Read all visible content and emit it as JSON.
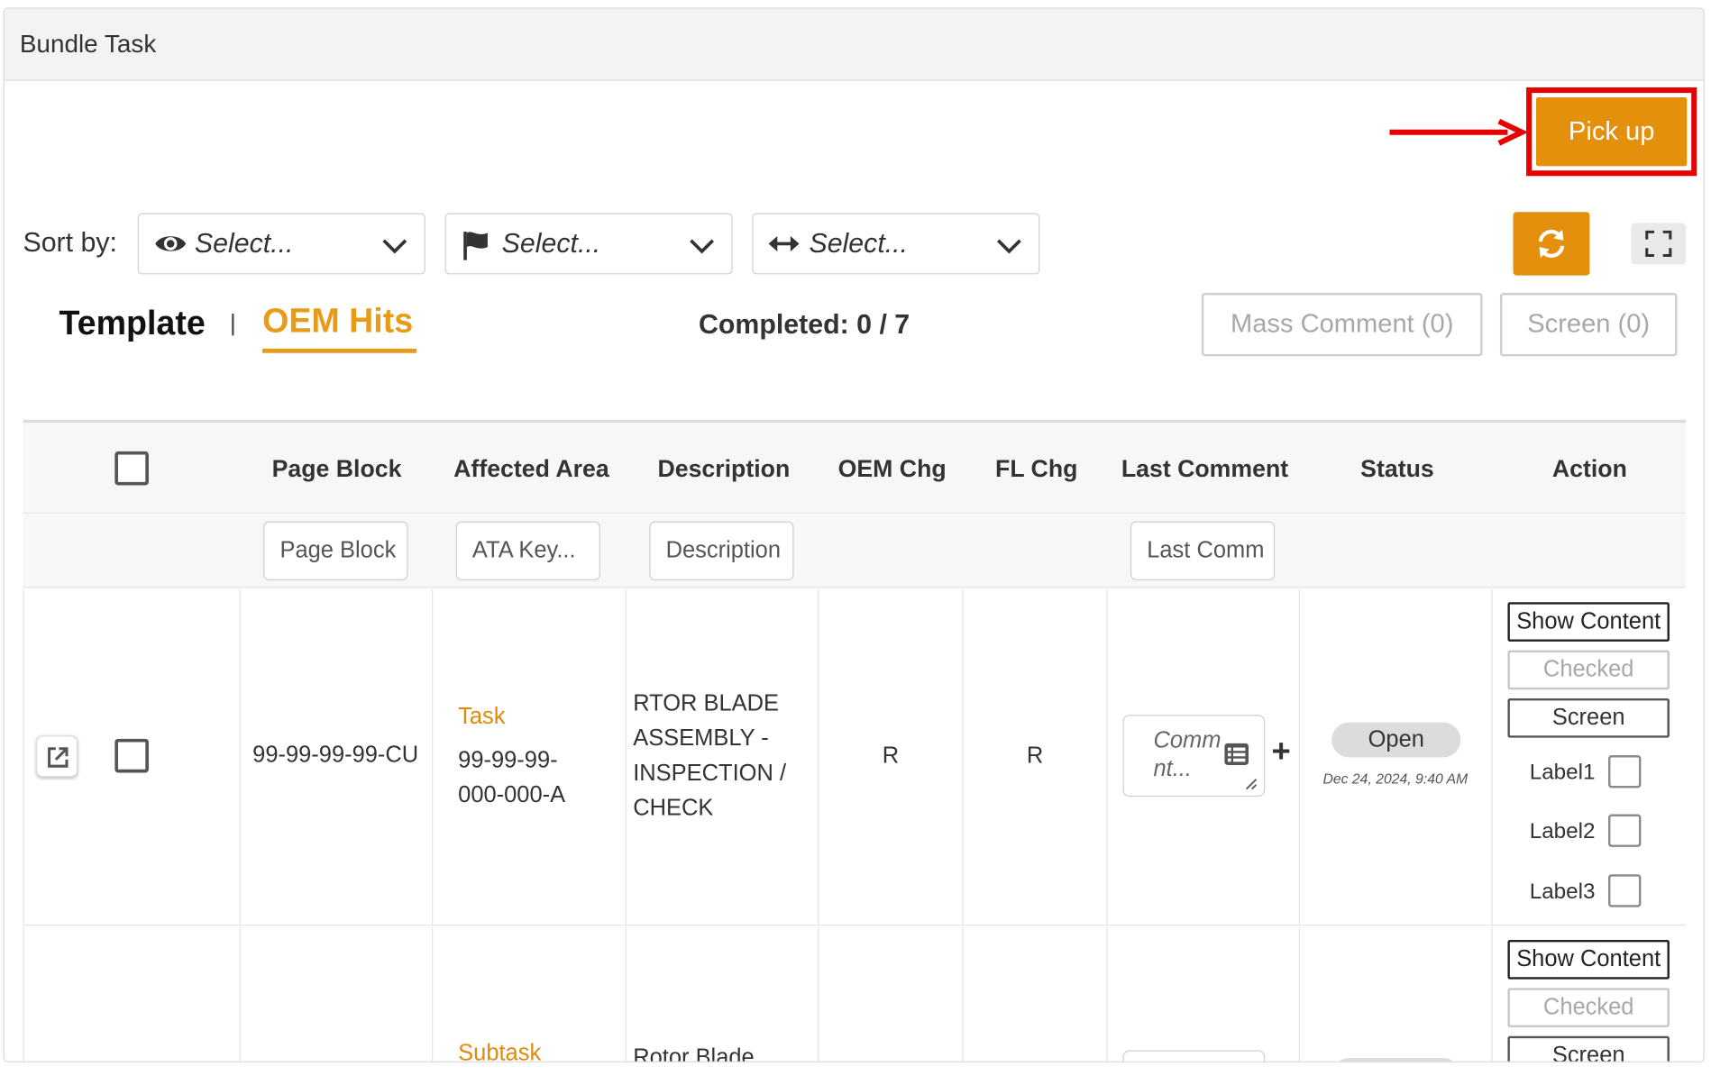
{
  "panel": {
    "title": "Bundle Task"
  },
  "pickup": {
    "label": "Pick up"
  },
  "sort": {
    "label": "Sort by:",
    "selects": [
      {
        "icon": "eye-icon",
        "placeholder": "Select..."
      },
      {
        "icon": "flag-icon",
        "placeholder": "Select..."
      },
      {
        "icon": "arrows-horizontal-icon",
        "placeholder": "Select..."
      }
    ]
  },
  "tabs": {
    "template": "Template",
    "oem_hits": "OEM Hits"
  },
  "completed": "Completed: 0 / 7",
  "buttons": {
    "mass_comment": "Mass Comment (0)",
    "screen": "Screen (0)"
  },
  "table": {
    "headers": {
      "page_block": "Page Block",
      "affected_area": "Affected Area",
      "description": "Description",
      "oem_chg": "OEM Chg",
      "fl_chg": "FL Chg",
      "last_comment": "Last Comment",
      "status": "Status",
      "action": "Action"
    },
    "filters": {
      "page_block": "Page Block",
      "affected_area": "ATA Key...",
      "description": "Description",
      "last_comment": "Last Comm"
    },
    "rows": [
      {
        "page_block": "99-99-99-99-CU",
        "type": "Task",
        "area_line1": "99-99-99-",
        "area_line2": "000-000-A",
        "desc_line1": "RTOR BLADE",
        "desc_line2": "ASSEMBLY -",
        "desc_line3": "INSPECTION /",
        "desc_line4": "CHECK",
        "oem_chg": "R",
        "fl_chg": "R",
        "comment_ph_line1": "Comm",
        "comment_ph_line2": "nt...",
        "status": "Open",
        "status_date": "Dec 24, 2024, 9:40 AM",
        "actions": {
          "show_content": "Show Content",
          "checked": "Checked",
          "screen": "Screen",
          "label1": "Label1",
          "label2": "Label2",
          "label3": "Label3"
        }
      },
      {
        "type": "Subtask",
        "desc_line1": "Rotor Blade",
        "actions": {
          "show_content": "Show Content",
          "checked": "Checked",
          "screen": "Screen"
        }
      }
    ]
  },
  "colors": {
    "accent": "#e4900c",
    "highlight": "#e60000"
  }
}
